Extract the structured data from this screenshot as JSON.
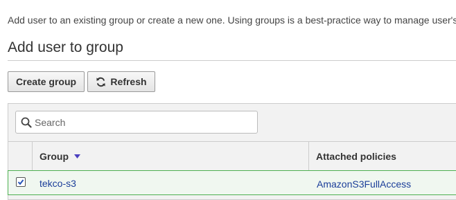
{
  "intro_text": "Add user to an existing group or create a new one. Using groups is a best-practice way to manage user's",
  "section_title": "Add user to group",
  "toolbar": {
    "create_group_label": "Create group",
    "refresh_label": "Refresh"
  },
  "search": {
    "placeholder": "Search",
    "value": ""
  },
  "table": {
    "columns": {
      "group": "Group",
      "attached_policies": "Attached policies"
    },
    "sort_direction": "descending",
    "rows": [
      {
        "selected": true,
        "group": "tekco-s3",
        "attached_policies": "AmazonS3FullAccess"
      }
    ]
  },
  "colors": {
    "link": "#1a3d99",
    "sort_arrow": "#4a3fbf",
    "selected_row_border": "#4caf50"
  }
}
